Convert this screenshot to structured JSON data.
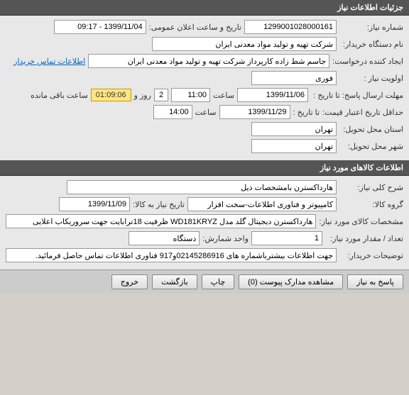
{
  "section1": {
    "title": "جزئیات اطلاعات نیاز",
    "request_number_label": "شماره نیاز:",
    "request_number": "1299001028000161",
    "announce_label": "تاریخ و ساعت اعلان عمومی:",
    "announce_value": "1399/11/04 - 09:17",
    "buyer_label": "نام دستگاه خریدار:",
    "buyer_value": "شرکت تهیه و تولید مواد معدنی ایران",
    "creator_label": "ایجاد کننده درخواست:",
    "creator_value": "جاسم شط زاده کارپرداز شرکت تهیه و تولید مواد معدنی ایران",
    "contact_link": "اطلاعات تماس خریدار",
    "priority_label": "اولویت نیاز :",
    "priority_value": "فوری",
    "deadline_label": "مهلت ارسال پاسخ:  تا تاریخ :",
    "deadline_date": "1399/11/06",
    "time_label": "ساعت",
    "deadline_time": "11:00",
    "days_value": "2",
    "days_label": "روز و",
    "countdown": "01:09:06",
    "remain_label": "ساعت باقی مانده",
    "min_validity_label": "حداقل تاریخ اعتبار قیمت:",
    "min_validity_label2": "تا تاریخ :",
    "min_validity_date": "1399/11/29",
    "min_validity_time": "14:00",
    "province_label": "استان محل تحویل:",
    "province_value": "تهران",
    "city_label": "شهر محل تحویل:",
    "city_value": "تهران"
  },
  "section2": {
    "title": "اطلاعات کالاهای مورد نیاز",
    "general_desc_label": "شرح کلی نیاز:",
    "general_desc": "هارداکسترن بامشخصات ذیل",
    "group_label": "گروه کالا:",
    "group_value": "کامپیوتر و فناوری اطلاعات-سخت افزار",
    "need_date_label": "تاریخ نیاز به کالا:",
    "need_date": "1399/11/09",
    "spec_label": "مشخصات کالای مورد نیاز:",
    "spec_value": "هارداکسترن دیجیتال گلد مدل WD181KRYZ ظرفیت 18ترابایت جهت سروریکاب اعلایی",
    "qty_label": "تعداد / مقدار مورد نیاز:",
    "qty_value": "1",
    "unit_label": "واحد شمارش:",
    "unit_value": "دستگاه",
    "buyer_notes_label": "توضیحات خریدار:",
    "buyer_notes": "جهت اطلاعات بیشترباشماره های 02145286916و917 فناوری اطلاعات تماس حاصل فرمائید."
  },
  "buttons": {
    "reply": "پاسخ به نیاز",
    "view_docs": "مشاهده مدارک پیوست  (0)",
    "print": "چاپ",
    "back": "بازگشت",
    "exit": "خروج"
  }
}
